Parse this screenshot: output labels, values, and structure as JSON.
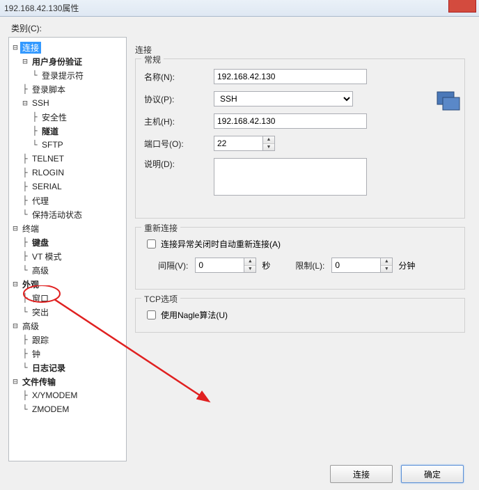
{
  "window": {
    "title": "192.168.42.130属性"
  },
  "category_label": "类别(C):",
  "tree": {
    "n_connection": "连接",
    "n_userauth": "用户身份验证",
    "n_loginprompt": "登录提示符",
    "n_loginscript": "登录脚本",
    "n_ssh": "SSH",
    "n_security": "安全性",
    "n_tunnel": "隧道",
    "n_sftp": "SFTP",
    "n_telnet": "TELNET",
    "n_rlogin": "RLOGIN",
    "n_serial": "SERIAL",
    "n_proxy": "代理",
    "n_keepalive": "保持活动状态",
    "n_terminal": "终端",
    "n_keyboard": "键盘",
    "n_vtmode": "VT 模式",
    "n_advanced1": "高级",
    "n_appearance": "外观",
    "n_window": "窗口",
    "n_highlight": "突出",
    "n_advanced2": "高级",
    "n_trace": "跟踪",
    "n_bell": "钟",
    "n_logging": "日志记录",
    "n_filetransfer": "文件传输",
    "n_xymodem": "X/YMODEM",
    "n_zmodem": "ZMODEM"
  },
  "panel": {
    "title": "连接",
    "group_general": "常规",
    "label_name": "名称(N):",
    "value_name": "192.168.42.130",
    "label_proto": "协议(P):",
    "value_proto": "SSH",
    "label_host": "主机(H):",
    "value_host": "192.168.42.130",
    "label_port": "端口号(O):",
    "value_port": "22",
    "label_desc": "说明(D):",
    "value_desc": "",
    "group_reconnect": "重新连接",
    "chk_reconnect": "连接异常关闭时自动重新连接(A)",
    "label_interval": "间隔(V):",
    "value_interval": "0",
    "unit_sec": "秒",
    "label_limit": "限制(L):",
    "value_limit": "0",
    "unit_min": "分钟",
    "group_tcp": "TCP选项",
    "chk_nagle": "使用Nagle算法(U)"
  },
  "buttons": {
    "connect": "连接",
    "ok": "确定"
  }
}
